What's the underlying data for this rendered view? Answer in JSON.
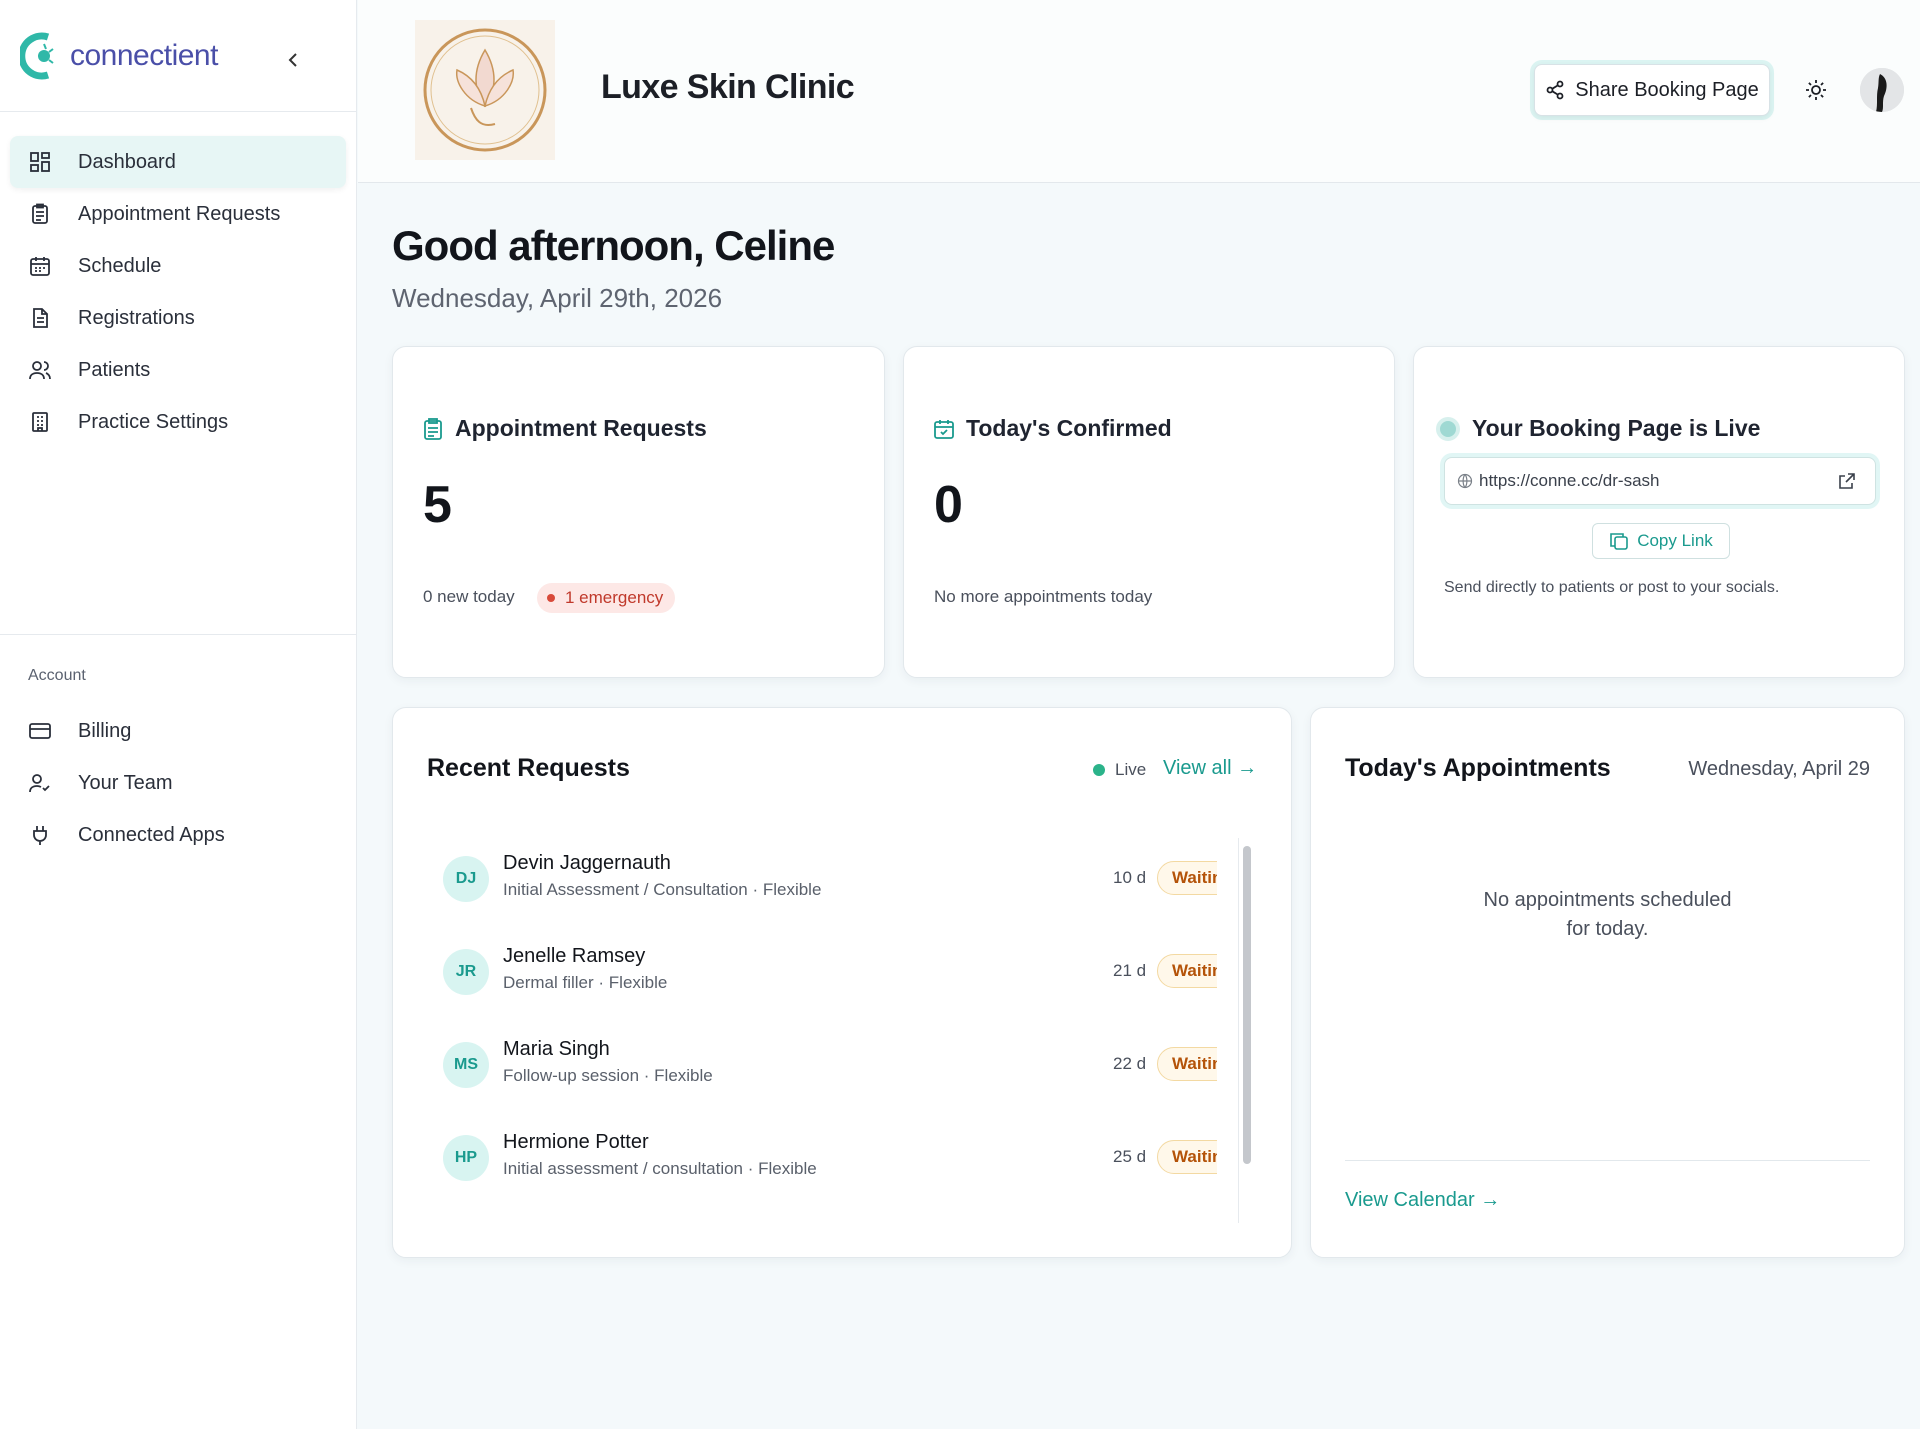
{
  "brand": {
    "name": "connectient"
  },
  "sidebar": {
    "items": [
      {
        "label": "Dashboard",
        "icon": "dashboard-grid-icon"
      },
      {
        "label": "Appointment Requests",
        "icon": "clipboard-icon"
      },
      {
        "label": "Schedule",
        "icon": "calendar-icon"
      },
      {
        "label": "Registrations",
        "icon": "document-icon"
      },
      {
        "label": "Patients",
        "icon": "users-icon"
      },
      {
        "label": "Practice Settings",
        "icon": "building-icon"
      }
    ],
    "account_label": "Account",
    "account_items": [
      {
        "label": "Billing",
        "icon": "credit-card-icon"
      },
      {
        "label": "Your Team",
        "icon": "user-check-icon"
      },
      {
        "label": "Connected Apps",
        "icon": "plug-icon"
      }
    ]
  },
  "header": {
    "clinic_name": "Luxe Skin Clinic",
    "share_label": "Share Booking Page"
  },
  "main": {
    "greeting": "Good afternoon, Celine",
    "date": "Wednesday, April 29th, 2026"
  },
  "stats": {
    "requests": {
      "title": "Appointment Requests",
      "value": "5",
      "sub": "0 new today",
      "badge": "1 emergency"
    },
    "confirmed": {
      "title": "Today's Confirmed",
      "value": "0",
      "sub": "No more appointments today"
    },
    "booking": {
      "title": "Your Booking Page is Live",
      "url": "https://conne.cc/dr-sash",
      "copy_label": "Copy Link",
      "sub": "Send directly to patients or post to your socials."
    }
  },
  "recent": {
    "title": "Recent Requests",
    "live_label": "Live",
    "view_all": "View all →",
    "rows": [
      {
        "initials": "DJ",
        "name": "Devin Jaggernauth",
        "detail": "Initial Assessment / Consultation · Flexible",
        "age": "10 d",
        "status": "Waiting"
      },
      {
        "initials": "JR",
        "name": "Jenelle Ramsey",
        "detail": "Dermal filler · Flexible",
        "age": "21 d",
        "status": "Waiting"
      },
      {
        "initials": "MS",
        "name": "Maria Singh",
        "detail": "Follow-up session · Flexible",
        "age": "22 d",
        "status": "Waiting"
      },
      {
        "initials": "HP",
        "name": "Hermione Potter",
        "detail": "Initial assessment / consultation · Flexible",
        "age": "25 d",
        "status": "Waiting"
      }
    ]
  },
  "appointments": {
    "title": "Today's Appointments",
    "date": "Wednesday, April 29",
    "empty": "No appointments scheduled for today.",
    "view_calendar": "View Calendar →"
  },
  "colors": {
    "accent": "#1a9a8e",
    "brand": "#4a4fa8",
    "waiting": "#b45309",
    "emergency": "#c0392b"
  }
}
